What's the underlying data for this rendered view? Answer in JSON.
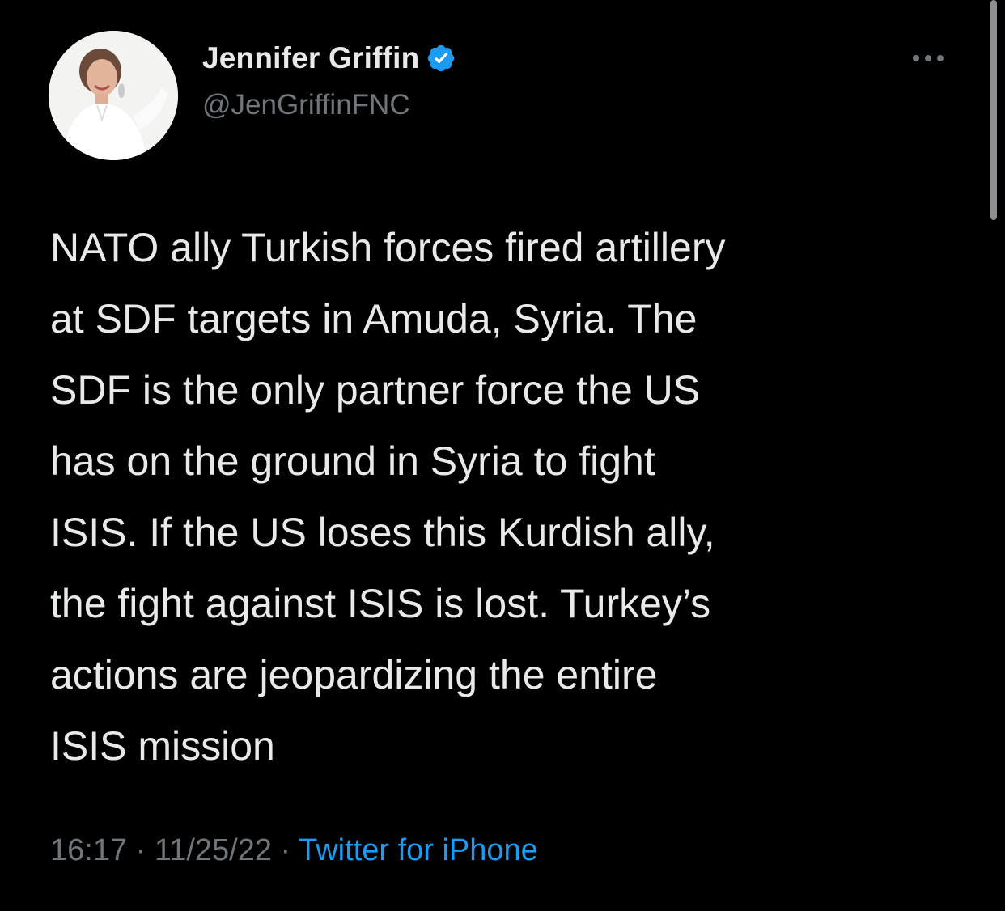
{
  "author": {
    "display_name": "Jennifer Griffin",
    "handle": "@JenGriffinFNC",
    "verified": true
  },
  "tweet": {
    "lines": [
      "NATO ally Turkish forces fired artillery",
      "at SDF targets in Amuda, Syria. The",
      "SDF is the only partner force the US",
      "has on the ground in Syria to fight",
      "ISIS. If the US loses this Kurdish ally,",
      "the fight against ISIS is lost. Turkey’s",
      "actions are jeopardizing the entire",
      "ISIS mission"
    ],
    "time": "16:17",
    "date": "11/25/22",
    "separator": "·",
    "source": "Twitter for iPhone"
  },
  "icons": {
    "verified": "verified-badge-icon",
    "more": "more-options-icon"
  },
  "colors": {
    "background": "#000000",
    "text": "#e7e9ea",
    "secondary": "#71767b",
    "accent": "#1d9bf0"
  }
}
